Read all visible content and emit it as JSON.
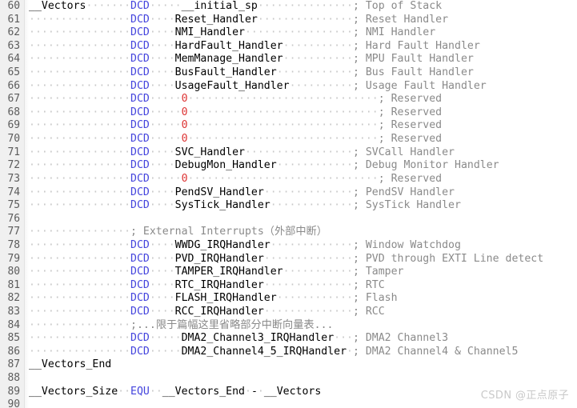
{
  "editor": {
    "language": "ARM Assembly",
    "first_line_number": 60,
    "last_line_number": 90,
    "colors": {
      "background": "#ffffff",
      "gutter_background": "#f0f0f0",
      "line_number": "#5c5c5c",
      "keyword": "#4444dd",
      "number": "#dd3333",
      "comment": "#8a8a8a",
      "identifier": "#000000",
      "whitespace_dot": "#c8c8c8"
    }
  },
  "watermark": {
    "text": "CSDN @正点原子"
  },
  "lines": [
    {
      "number": "60",
      "tokens": [
        {
          "type": "id",
          "text": "__Vectors"
        },
        {
          "type": "dot",
          "text": "·······"
        },
        {
          "type": "kw",
          "text": "DCD"
        },
        {
          "type": "dot",
          "text": "·····"
        },
        {
          "type": "id",
          "text": "__initial_sp"
        },
        {
          "type": "dot",
          "text": "···············"
        },
        {
          "type": "cmt",
          "text": "; Top of Stack"
        }
      ]
    },
    {
      "number": "61",
      "tokens": [
        {
          "type": "dot",
          "text": "················"
        },
        {
          "type": "kw",
          "text": "DCD"
        },
        {
          "type": "dot",
          "text": "····"
        },
        {
          "type": "id",
          "text": "Reset_Handler"
        },
        {
          "type": "dot",
          "text": "···············"
        },
        {
          "type": "cmt",
          "text": "; Reset Handler"
        }
      ]
    },
    {
      "number": "62",
      "tokens": [
        {
          "type": "dot",
          "text": "················"
        },
        {
          "type": "kw",
          "text": "DCD"
        },
        {
          "type": "dot",
          "text": "····"
        },
        {
          "type": "id",
          "text": "NMI_Handler"
        },
        {
          "type": "dot",
          "text": "·················"
        },
        {
          "type": "cmt",
          "text": "; NMI Handler"
        }
      ]
    },
    {
      "number": "63",
      "tokens": [
        {
          "type": "dot",
          "text": "················"
        },
        {
          "type": "kw",
          "text": "DCD"
        },
        {
          "type": "dot",
          "text": "····"
        },
        {
          "type": "id",
          "text": "HardFault_Handler"
        },
        {
          "type": "dot",
          "text": "···········"
        },
        {
          "type": "cmt",
          "text": "; Hard Fault Handler"
        }
      ]
    },
    {
      "number": "64",
      "tokens": [
        {
          "type": "dot",
          "text": "················"
        },
        {
          "type": "kw",
          "text": "DCD"
        },
        {
          "type": "dot",
          "text": "····"
        },
        {
          "type": "id",
          "text": "MemManage_Handler"
        },
        {
          "type": "dot",
          "text": "···········"
        },
        {
          "type": "cmt",
          "text": "; MPU Fault Handler"
        }
      ]
    },
    {
      "number": "65",
      "tokens": [
        {
          "type": "dot",
          "text": "················"
        },
        {
          "type": "kw",
          "text": "DCD"
        },
        {
          "type": "dot",
          "text": "····"
        },
        {
          "type": "id",
          "text": "BusFault_Handler"
        },
        {
          "type": "dot",
          "text": "············"
        },
        {
          "type": "cmt",
          "text": "; Bus Fault Handler"
        }
      ]
    },
    {
      "number": "66",
      "tokens": [
        {
          "type": "dot",
          "text": "················"
        },
        {
          "type": "kw",
          "text": "DCD"
        },
        {
          "type": "dot",
          "text": "····"
        },
        {
          "type": "id",
          "text": "UsageFault_Handler"
        },
        {
          "type": "dot",
          "text": "··········"
        },
        {
          "type": "cmt",
          "text": "; Usage Fault Handler"
        }
      ]
    },
    {
      "number": "67",
      "tokens": [
        {
          "type": "dot",
          "text": "················"
        },
        {
          "type": "kw",
          "text": "DCD"
        },
        {
          "type": "dot",
          "text": "·····"
        },
        {
          "type": "num",
          "text": "0"
        },
        {
          "type": "dot",
          "text": "······························"
        },
        {
          "type": "cmt",
          "text": "; Reserved"
        }
      ]
    },
    {
      "number": "68",
      "tokens": [
        {
          "type": "dot",
          "text": "················"
        },
        {
          "type": "kw",
          "text": "DCD"
        },
        {
          "type": "dot",
          "text": "·····"
        },
        {
          "type": "num",
          "text": "0"
        },
        {
          "type": "dot",
          "text": "······························"
        },
        {
          "type": "cmt",
          "text": "; Reserved"
        }
      ]
    },
    {
      "number": "69",
      "tokens": [
        {
          "type": "dot",
          "text": "················"
        },
        {
          "type": "kw",
          "text": "DCD"
        },
        {
          "type": "dot",
          "text": "·····"
        },
        {
          "type": "num",
          "text": "0"
        },
        {
          "type": "dot",
          "text": "······························"
        },
        {
          "type": "cmt",
          "text": "; Reserved"
        }
      ]
    },
    {
      "number": "70",
      "tokens": [
        {
          "type": "dot",
          "text": "················"
        },
        {
          "type": "kw",
          "text": "DCD"
        },
        {
          "type": "dot",
          "text": "·····"
        },
        {
          "type": "num",
          "text": "0"
        },
        {
          "type": "dot",
          "text": "······························"
        },
        {
          "type": "cmt",
          "text": "; Reserved"
        }
      ]
    },
    {
      "number": "71",
      "tokens": [
        {
          "type": "dot",
          "text": "················"
        },
        {
          "type": "kw",
          "text": "DCD"
        },
        {
          "type": "dot",
          "text": "····"
        },
        {
          "type": "id",
          "text": "SVC_Handler"
        },
        {
          "type": "dot",
          "text": "·················"
        },
        {
          "type": "cmt",
          "text": "; SVCall Handler"
        }
      ]
    },
    {
      "number": "72",
      "tokens": [
        {
          "type": "dot",
          "text": "················"
        },
        {
          "type": "kw",
          "text": "DCD"
        },
        {
          "type": "dot",
          "text": "····"
        },
        {
          "type": "id",
          "text": "DebugMon_Handler"
        },
        {
          "type": "dot",
          "text": "············"
        },
        {
          "type": "cmt",
          "text": "; Debug Monitor Handler"
        }
      ]
    },
    {
      "number": "73",
      "tokens": [
        {
          "type": "dot",
          "text": "················"
        },
        {
          "type": "kw",
          "text": "DCD"
        },
        {
          "type": "dot",
          "text": "·····"
        },
        {
          "type": "num",
          "text": "0"
        },
        {
          "type": "dot",
          "text": "······························"
        },
        {
          "type": "cmt",
          "text": "; Reserved"
        }
      ]
    },
    {
      "number": "74",
      "tokens": [
        {
          "type": "dot",
          "text": "················"
        },
        {
          "type": "kw",
          "text": "DCD"
        },
        {
          "type": "dot",
          "text": "····"
        },
        {
          "type": "id",
          "text": "PendSV_Handler"
        },
        {
          "type": "dot",
          "text": "··············"
        },
        {
          "type": "cmt",
          "text": "; PendSV Handler"
        }
      ]
    },
    {
      "number": "75",
      "tokens": [
        {
          "type": "dot",
          "text": "················"
        },
        {
          "type": "kw",
          "text": "DCD"
        },
        {
          "type": "dot",
          "text": "····"
        },
        {
          "type": "id",
          "text": "SysTick_Handler"
        },
        {
          "type": "dot",
          "text": "·············"
        },
        {
          "type": "cmt",
          "text": "; SysTick Handler"
        }
      ]
    },
    {
      "number": "76",
      "tokens": []
    },
    {
      "number": "77",
      "tokens": [
        {
          "type": "dot",
          "text": "················"
        },
        {
          "type": "cmt",
          "text": "; External Interrupts"
        },
        {
          "type": "cjk",
          "text": "（外部中断）"
        }
      ]
    },
    {
      "number": "78",
      "tokens": [
        {
          "type": "dot",
          "text": "················"
        },
        {
          "type": "kw",
          "text": "DCD"
        },
        {
          "type": "dot",
          "text": "····"
        },
        {
          "type": "id",
          "text": "WWDG_IRQHandler"
        },
        {
          "type": "dot",
          "text": "·············"
        },
        {
          "type": "cmt",
          "text": "; Window Watchdog"
        }
      ]
    },
    {
      "number": "79",
      "tokens": [
        {
          "type": "dot",
          "text": "················"
        },
        {
          "type": "kw",
          "text": "DCD"
        },
        {
          "type": "dot",
          "text": "····"
        },
        {
          "type": "id",
          "text": "PVD_IRQHandler"
        },
        {
          "type": "dot",
          "text": "··············"
        },
        {
          "type": "cmt",
          "text": "; PVD through EXTI Line detect"
        }
      ]
    },
    {
      "number": "80",
      "tokens": [
        {
          "type": "dot",
          "text": "················"
        },
        {
          "type": "kw",
          "text": "DCD"
        },
        {
          "type": "dot",
          "text": "····"
        },
        {
          "type": "id",
          "text": "TAMPER_IRQHandler"
        },
        {
          "type": "dot",
          "text": "···········"
        },
        {
          "type": "cmt",
          "text": "; Tamper"
        }
      ]
    },
    {
      "number": "81",
      "tokens": [
        {
          "type": "dot",
          "text": "················"
        },
        {
          "type": "kw",
          "text": "DCD"
        },
        {
          "type": "dot",
          "text": "····"
        },
        {
          "type": "id",
          "text": "RTC_IRQHandler"
        },
        {
          "type": "dot",
          "text": "··············"
        },
        {
          "type": "cmt",
          "text": "; RTC"
        }
      ]
    },
    {
      "number": "82",
      "tokens": [
        {
          "type": "dot",
          "text": "················"
        },
        {
          "type": "kw",
          "text": "DCD"
        },
        {
          "type": "dot",
          "text": "····"
        },
        {
          "type": "id",
          "text": "FLASH_IRQHandler"
        },
        {
          "type": "dot",
          "text": "············"
        },
        {
          "type": "cmt",
          "text": "; Flash"
        }
      ]
    },
    {
      "number": "83",
      "tokens": [
        {
          "type": "dot",
          "text": "················"
        },
        {
          "type": "kw",
          "text": "DCD"
        },
        {
          "type": "dot",
          "text": "····"
        },
        {
          "type": "id",
          "text": "RCC_IRQHandler"
        },
        {
          "type": "dot",
          "text": "··············"
        },
        {
          "type": "cmt",
          "text": "; RCC"
        }
      ]
    },
    {
      "number": "84",
      "tokens": [
        {
          "type": "dot",
          "text": "················"
        },
        {
          "type": "cmt",
          "text": ";..."
        },
        {
          "type": "cjk",
          "text": "限于篇幅这里省略部分中断向量表"
        },
        {
          "type": "cmt",
          "text": "..."
        }
      ]
    },
    {
      "number": "85",
      "tokens": [
        {
          "type": "dot",
          "text": "················"
        },
        {
          "type": "kw",
          "text": "DCD"
        },
        {
          "type": "dot",
          "text": "·····"
        },
        {
          "type": "id",
          "text": "DMA2_Channel3_IRQHandler"
        },
        {
          "type": "dot",
          "text": "···"
        },
        {
          "type": "cmt",
          "text": "; DMA2 Channel3"
        }
      ]
    },
    {
      "number": "86",
      "tokens": [
        {
          "type": "dot",
          "text": "················"
        },
        {
          "type": "kw",
          "text": "DCD"
        },
        {
          "type": "dot",
          "text": "·····"
        },
        {
          "type": "id",
          "text": "DMA2_Channel4_5_IRQHandler"
        },
        {
          "type": "dot",
          "text": "·"
        },
        {
          "type": "cmt",
          "text": "; DMA2 Channel4 & Channel5"
        }
      ]
    },
    {
      "number": "87",
      "tokens": [
        {
          "type": "id",
          "text": "__Vectors_End"
        }
      ]
    },
    {
      "number": "88",
      "tokens": []
    },
    {
      "number": "89",
      "tokens": [
        {
          "type": "id",
          "text": "__Vectors_Size"
        },
        {
          "type": "dot",
          "text": "··"
        },
        {
          "type": "kw",
          "text": "EQU"
        },
        {
          "type": "dot",
          "text": "··"
        },
        {
          "type": "id",
          "text": "__Vectors_End"
        },
        {
          "type": "dot",
          "text": "·"
        },
        {
          "type": "id",
          "text": "-"
        },
        {
          "type": "dot",
          "text": "·"
        },
        {
          "type": "id",
          "text": "__Vectors"
        }
      ]
    },
    {
      "number": "90",
      "tokens": []
    }
  ]
}
